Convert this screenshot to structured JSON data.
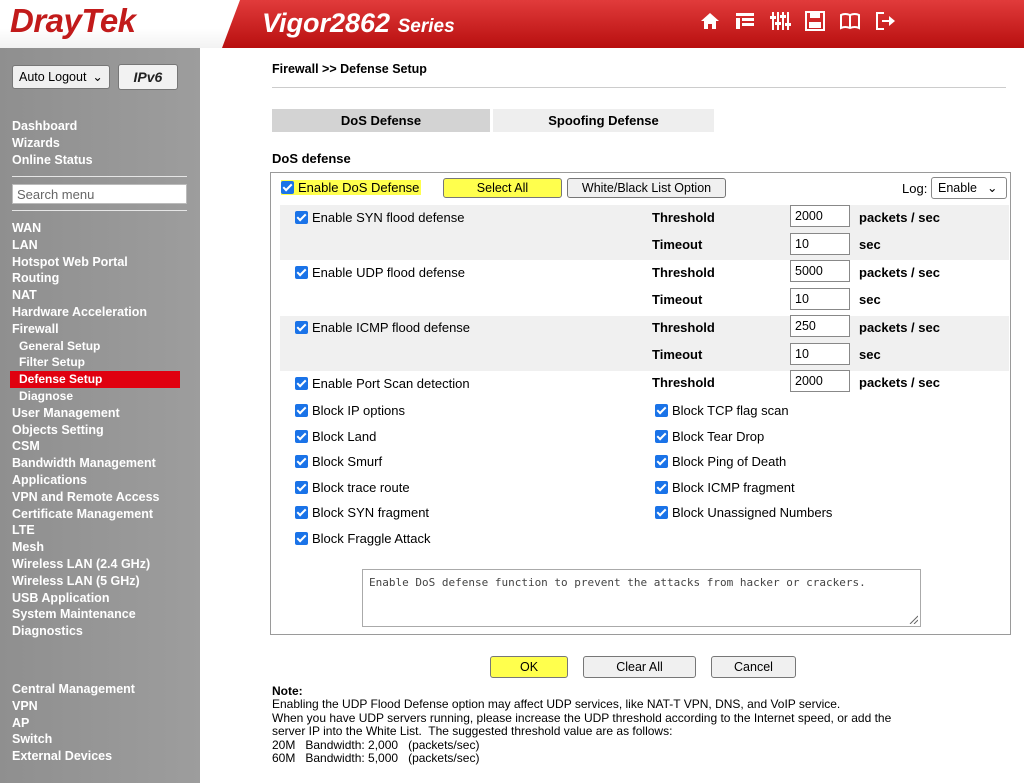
{
  "header": {
    "logo": "DrayTek",
    "model_main": "Vigor2862",
    "model_series": "Series",
    "icons": [
      "home-icon",
      "list-icon",
      "sliders-icon",
      "save-icon",
      "manual-icon",
      "logout-icon"
    ]
  },
  "sidebar": {
    "auto_logout": "Auto Logout",
    "ipv6_badge": "IPv6",
    "top_items": [
      "Dashboard",
      "Wizards",
      "Online Status"
    ],
    "search_placeholder": "Search menu",
    "items": [
      "WAN",
      "LAN",
      "Hotspot Web Portal",
      "Routing",
      "NAT",
      "Hardware Acceleration",
      "Firewall"
    ],
    "firewall_sub": [
      "General Setup",
      "Filter Setup",
      "Defense Setup",
      "Diagnose"
    ],
    "items2": [
      "User Management",
      "Objects Setting",
      "CSM",
      "Bandwidth Management",
      "Applications",
      "VPN and Remote Access",
      "Certificate Management",
      "LTE",
      "Mesh",
      "Wireless LAN (2.4 GHz)",
      "Wireless LAN (5 GHz)",
      "USB Application",
      "System Maintenance",
      "Diagnostics"
    ],
    "central": [
      "Central Management",
      "VPN",
      "AP",
      "Switch",
      "External Devices"
    ]
  },
  "main": {
    "breadcrumb": "Firewall >> Defense Setup",
    "tabs": [
      "DoS Defense",
      "Spoofing Defense"
    ],
    "section_title": "DoS defense",
    "enable_dos": "Enable DoS Defense",
    "select_all": "Select All",
    "wb_list": "White/Black List Option",
    "log_label": "Log:",
    "log_value": "Enable",
    "threshold": "Threshold",
    "timeout": "Timeout",
    "pps": "packets / sec",
    "sec": "sec",
    "syn": {
      "label": "Enable SYN flood defense",
      "threshold": "2000",
      "timeout": "10"
    },
    "udp": {
      "label": "Enable UDP flood defense",
      "threshold": "5000",
      "timeout": "10"
    },
    "icmp": {
      "label": "Enable ICMP flood defense",
      "threshold": "250",
      "timeout": "10"
    },
    "portscan": {
      "label": "Enable Port Scan detection",
      "threshold": "2000"
    },
    "left_blocks": [
      "Block IP options",
      "Block Land",
      "Block Smurf",
      "Block trace route",
      "Block SYN fragment",
      "Block Fraggle Attack"
    ],
    "right_blocks": [
      "Block TCP flag scan",
      "Block Tear Drop",
      "Block Ping of Death",
      "Block ICMP fragment",
      "Block Unassigned Numbers"
    ],
    "description": "Enable DoS defense function to prevent the attacks from hacker or crackers.",
    "buttons": {
      "ok": "OK",
      "clear": "Clear All",
      "cancel": "Cancel"
    },
    "note_title": "Note:",
    "notes": [
      "Enabling the UDP Flood Defense option may affect UDP services, like NAT-T VPN, DNS, and VoIP service.",
      "When you have UDP servers running, please increase the UDP threshold according to the Internet speed, or add the",
      "server IP into the White List.  The suggested threshold value are as follows:",
      "20M   Bandwidth: 2,000   (packets/sec)",
      "60M   Bandwidth: 5,000   (packets/sec)"
    ]
  },
  "colors": {
    "brand_red": "#c21b1b",
    "active_menu": "#e0000f",
    "highlight": "#ffff4d",
    "checkbox": "#1a73e8"
  }
}
